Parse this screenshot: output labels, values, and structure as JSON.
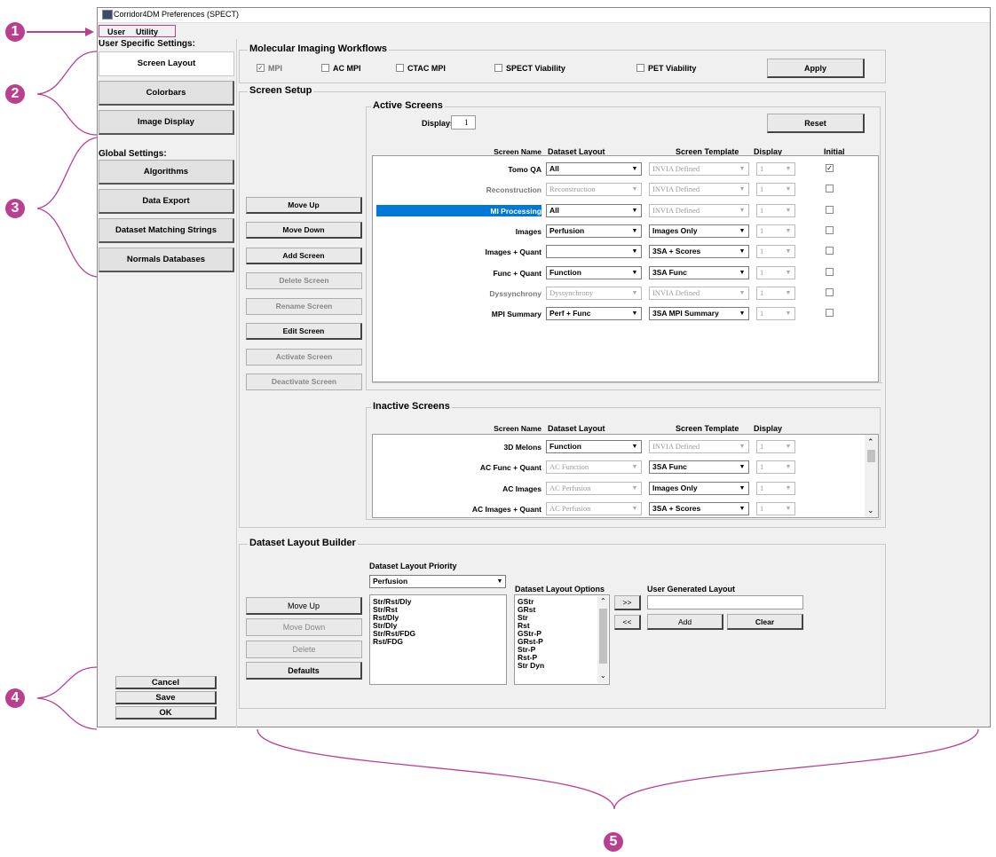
{
  "window": {
    "title": "Corridor4DM Preferences (SPECT)"
  },
  "menu": {
    "items": [
      "User",
      "Utility"
    ]
  },
  "annotations": [
    "1",
    "2",
    "3",
    "4",
    "5"
  ],
  "sidebar": {
    "user_label": "User Specific Settings:",
    "user_items": [
      "Screen Layout",
      "Colorbars",
      "Image Display"
    ],
    "global_label": "Global Settings:",
    "global_items": [
      "Algorithms",
      "Data Export",
      "Dataset Matching Strings",
      "Normals Databases"
    ],
    "footer_buttons": [
      "Cancel",
      "Save",
      "OK"
    ]
  },
  "workflows": {
    "title": "Molecular Imaging Workflows",
    "options": [
      {
        "label": "MPI",
        "checked": true
      },
      {
        "label": "AC MPI",
        "checked": false
      },
      {
        "label": "CTAC MPI",
        "checked": false
      },
      {
        "label": "SPECT Viability",
        "checked": false
      },
      {
        "label": "PET Viability",
        "checked": false
      }
    ],
    "apply": "Apply"
  },
  "screen_setup": {
    "title": "Screen Setup",
    "buttons": [
      "Move Up",
      "Move Down",
      "Add Screen",
      "Delete Screen",
      "Rename Screen",
      "Edit Screen",
      "Activate Screen",
      "Deactivate Screen"
    ],
    "active": {
      "title": "Active Screens",
      "displays_label": "Displays",
      "displays_value": "1",
      "reset": "Reset",
      "headers": [
        "Screen Name",
        "Dataset Layout",
        "Screen Template",
        "Display",
        "Initial"
      ],
      "rows": [
        {
          "name": "Tomo QA",
          "layout": "All",
          "template": "INVIA Defined",
          "display": "1",
          "initial": true
        },
        {
          "name": "Reconstruction",
          "layout": "Reconstruction",
          "template": "INVIA Defined",
          "display": "1",
          "initial": false
        },
        {
          "name": "MI Processing",
          "layout": "All",
          "template": "INVIA Defined",
          "display": "1",
          "initial": false
        },
        {
          "name": "Images",
          "layout": "Perfusion",
          "template": "Images Only",
          "display": "1",
          "initial": false
        },
        {
          "name": "Images + Quant",
          "layout": "",
          "template": "3SA + Scores",
          "display": "1",
          "initial": false
        },
        {
          "name": "Func + Quant",
          "layout": "Function",
          "template": "3SA Func",
          "display": "1",
          "initial": false
        },
        {
          "name": "Dyssynchrony",
          "layout": "Dyssynchrony",
          "template": "INVIA Defined",
          "display": "1",
          "initial": false
        },
        {
          "name": "MPI Summary",
          "layout": "Perf + Func",
          "template": "3SA MPI Summary",
          "display": "1",
          "initial": false
        }
      ]
    },
    "inactive": {
      "title": "Inactive Screens",
      "headers": [
        "Screen Name",
        "Dataset Layout",
        "Screen Template",
        "Display"
      ],
      "rows": [
        {
          "name": "3D Melons",
          "layout": "Function",
          "template": "INVIA Defined",
          "display": "1"
        },
        {
          "name": "AC Func + Quant",
          "layout": "AC Function",
          "template": "3SA Func",
          "display": "1"
        },
        {
          "name": "AC Images",
          "layout": "AC Perfusion",
          "template": "Images Only",
          "display": "1"
        },
        {
          "name": "AC Images + Quant",
          "layout": "AC Perfusion",
          "template": "3SA + Scores",
          "display": "1"
        }
      ]
    }
  },
  "builder": {
    "title": "Dataset Layout Builder",
    "priority_label": "Dataset Layout Priority",
    "priority_value": "Perfusion",
    "buttons": [
      "Move Up",
      "Move Down",
      "Delete",
      "Defaults"
    ],
    "priority_items": [
      "Str/Rst/Dly",
      "Str/Rst",
      "Rst/Dly",
      "Str/Dly",
      "Str/Rst/FDG",
      "Rst/FDG"
    ],
    "options_label": "Dataset Layout Options",
    "options_items": [
      "GStr",
      "GRst",
      "Str",
      "Rst",
      "GStr-P",
      "GRst-P",
      "Str-P",
      "Rst-P",
      "Str Dyn"
    ],
    "right_btn": ">>",
    "left_btn": "<<",
    "user_label": "User Generated Layout",
    "add": "Add",
    "clear": "Clear"
  }
}
